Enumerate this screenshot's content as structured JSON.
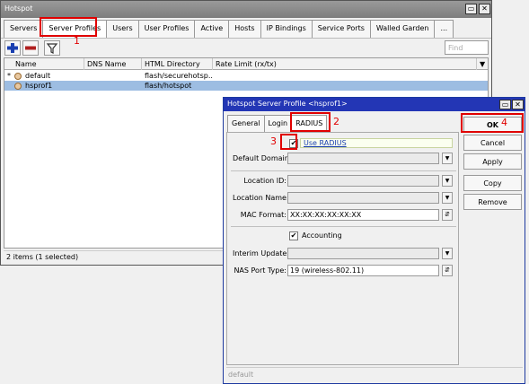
{
  "hotspot_window": {
    "title": "Hotspot",
    "tabs": [
      "Servers",
      "Server Profiles",
      "Users",
      "User Profiles",
      "Active",
      "Hosts",
      "IP Bindings",
      "Service Ports",
      "Walled Garden",
      "..."
    ],
    "toolbar": {
      "find_placeholder": "Find"
    },
    "columns": [
      "Name",
      "DNS Name",
      "HTML Directory",
      "Rate Limit (rx/tx)"
    ],
    "rows": [
      {
        "marker": "*",
        "name": "default",
        "dns": "",
        "html_dir": "flash/securehotsp...",
        "rate": "",
        "selected": false
      },
      {
        "marker": "",
        "name": "hsprof1",
        "dns": "",
        "html_dir": "flash/hotspot",
        "rate": "",
        "selected": true
      }
    ],
    "status": "2 items (1 selected)"
  },
  "profile_window": {
    "title": "Hotspot Server Profile <hsprof1>",
    "tabs": [
      "General",
      "Login",
      "RADIUS"
    ],
    "use_radius_label": "Use RADIUS",
    "labels": {
      "default_domain": "Default Domain:",
      "location_id": "Location ID:",
      "location_name": "Location Name:",
      "mac_format": "MAC Format:",
      "accounting": "Accounting",
      "interim_update": "Interim Update:",
      "nas_port_type": "NAS Port Type:"
    },
    "values": {
      "mac_format": "XX:XX:XX:XX:XX:XX",
      "nas_port_type": "19 (wireless-802.11)"
    },
    "buttons": [
      "OK",
      "Cancel",
      "Apply",
      "Copy",
      "Remove"
    ],
    "status": "default"
  },
  "annotations": [
    "1",
    "2",
    "3",
    "4"
  ],
  "colors": {
    "annotation": "#e00000",
    "selection": "#9dbde2",
    "title_blue": "#2336b5"
  }
}
